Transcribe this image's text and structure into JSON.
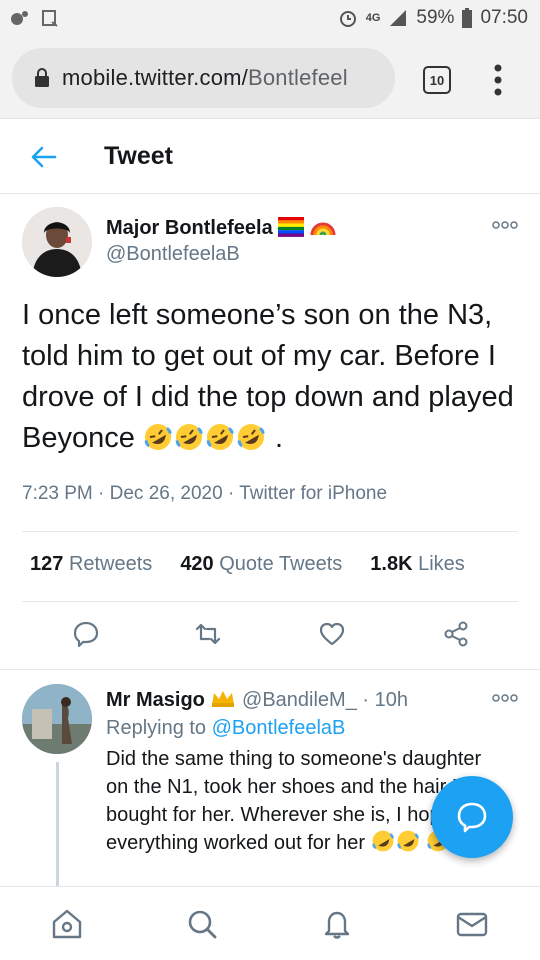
{
  "status_bar": {
    "network": "4G",
    "battery": "59%",
    "time": "07:50"
  },
  "browser": {
    "url_domain": "mobile.twitter.com/",
    "url_path": "Bontlefeel",
    "tab_count": "10"
  },
  "header": {
    "title": "Tweet"
  },
  "tweet": {
    "author_name": "Major Bontlefeela",
    "author_handle": "@BontlefeelaB",
    "text": "I once left someone’s son on the N3, told him to get out of my car. Before I drove of I did the top down and played Beyonce",
    "emoji_name": "rolling-on-floor-laughing-emoji",
    "text_end": ".",
    "meta": "7:23 PM · Dec 26, 2020 · Twitter for iPhone",
    "retweets_count": "127",
    "retweets_label": "Retweets",
    "quote_count": "420",
    "quote_label": "Quote Tweets",
    "likes_count": "1.8K",
    "likes_label": "Likes"
  },
  "reply": {
    "author_name": "Mr Masigo",
    "author_handle": "@BandileM_",
    "time": "· 10h",
    "replying_to_label": "Replying to",
    "replying_to_handle": "@BontlefeelaB",
    "text": "Did the same thing to someone's daughter on the N1, took her shoes and the hair I bought for her. Wherever she is, I hope everything worked out for her"
  },
  "colors": {
    "twitter_blue": "#1da1f2",
    "secondary_text": "#657786",
    "primary_text": "#14171a",
    "divider": "#e1e8ed"
  }
}
